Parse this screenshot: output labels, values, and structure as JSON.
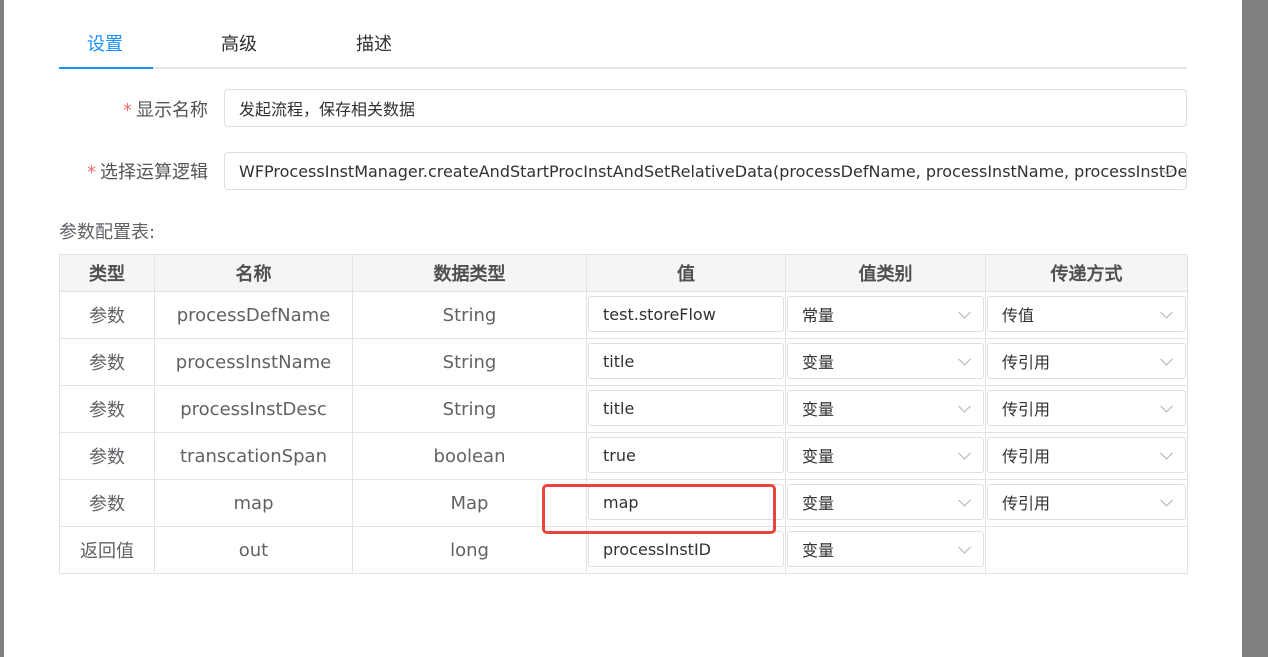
{
  "tabs": [
    {
      "label": "设置",
      "active": true
    },
    {
      "label": "高级",
      "active": false
    },
    {
      "label": "描述",
      "active": false
    }
  ],
  "form": {
    "display_name": {
      "required": "*",
      "label": "显示名称",
      "value": "发起流程，保存相关数据"
    },
    "logic": {
      "required": "*",
      "label": "选择运算逻辑",
      "value": "WFProcessInstManager.createAndStartProcInstAndSetRelativeData(processDefName, processInstName, processInstDesc,"
    }
  },
  "param_table": {
    "title": "参数配置表:",
    "headers": [
      "类型",
      "名称",
      "数据类型",
      "值",
      "值类别",
      "传递方式"
    ],
    "rows": [
      {
        "type": "参数",
        "name": "processDefName",
        "data_type": "String",
        "value": "test.storeFlow",
        "value_category": "常量",
        "pass_mode": "传值"
      },
      {
        "type": "参数",
        "name": "processInstName",
        "data_type": "String",
        "value": "title",
        "value_category": "变量",
        "pass_mode": "传引用"
      },
      {
        "type": "参数",
        "name": "processInstDesc",
        "data_type": "String",
        "value": "title",
        "value_category": "变量",
        "pass_mode": "传引用"
      },
      {
        "type": "参数",
        "name": "transcationSpan",
        "data_type": "boolean",
        "value": "true",
        "value_category": "变量",
        "pass_mode": "传引用"
      },
      {
        "type": "参数",
        "name": "map",
        "data_type": "Map",
        "value": "map",
        "value_category": "变量",
        "pass_mode": "传引用"
      },
      {
        "type": "返回值",
        "name": "out",
        "data_type": "long",
        "value": "processInstID",
        "value_category": "变量",
        "pass_mode": ""
      }
    ]
  },
  "colors": {
    "accent": "#1890ff",
    "required": "#f56c6c",
    "highlight": "#e8453c"
  }
}
